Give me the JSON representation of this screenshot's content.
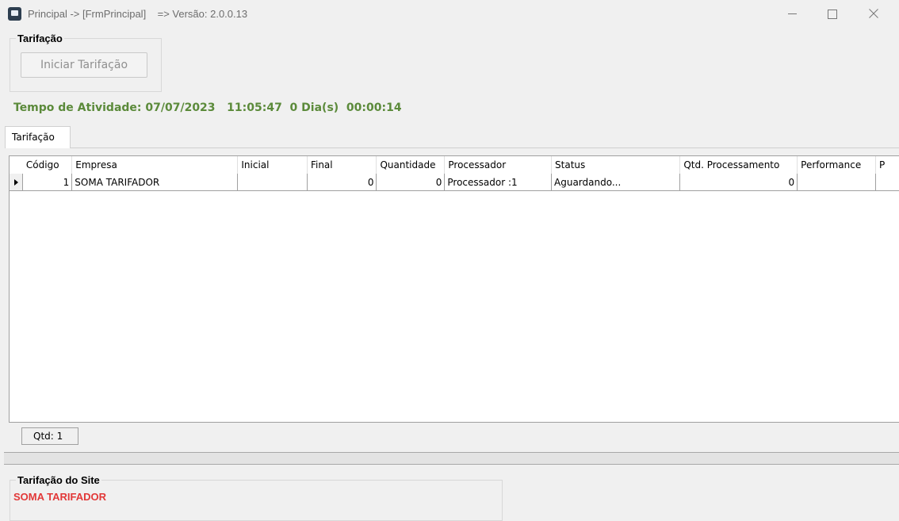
{
  "window": {
    "title": "Principal -> [FrmPrincipal]    => Versão: 2.0.0.13"
  },
  "group_tarifacao": {
    "legend": "Tarifação",
    "start_button": "Iniciar Tarifação"
  },
  "uptime": "Tempo de Atividade: 07/07/2023   11:05:47  0 Dia(s)  00:00:14",
  "tabs": [
    {
      "label": "Tarifação",
      "active": true
    }
  ],
  "grid": {
    "columns": [
      "Código",
      "Empresa",
      "Inicial",
      "Final",
      "Quantidade",
      "Processador",
      "Status",
      "Qtd. Processamento",
      "Performance",
      "P"
    ],
    "rows": [
      {
        "codigo": "1",
        "empresa": "SOMA TARIFADOR",
        "inicial": "",
        "final": "0",
        "quantidade": "0",
        "processador": "Processador :1",
        "status": "Aguardando...",
        "qtd_processamento": "0",
        "performance": "",
        "p": ""
      }
    ],
    "footer": "Qtd: 1"
  },
  "group_site": {
    "legend": "Tarifação do Site",
    "value": "SOMA TARIFADOR"
  },
  "colors": {
    "uptime_text": "#5b8a3a",
    "site_value_text": "#e23838"
  }
}
